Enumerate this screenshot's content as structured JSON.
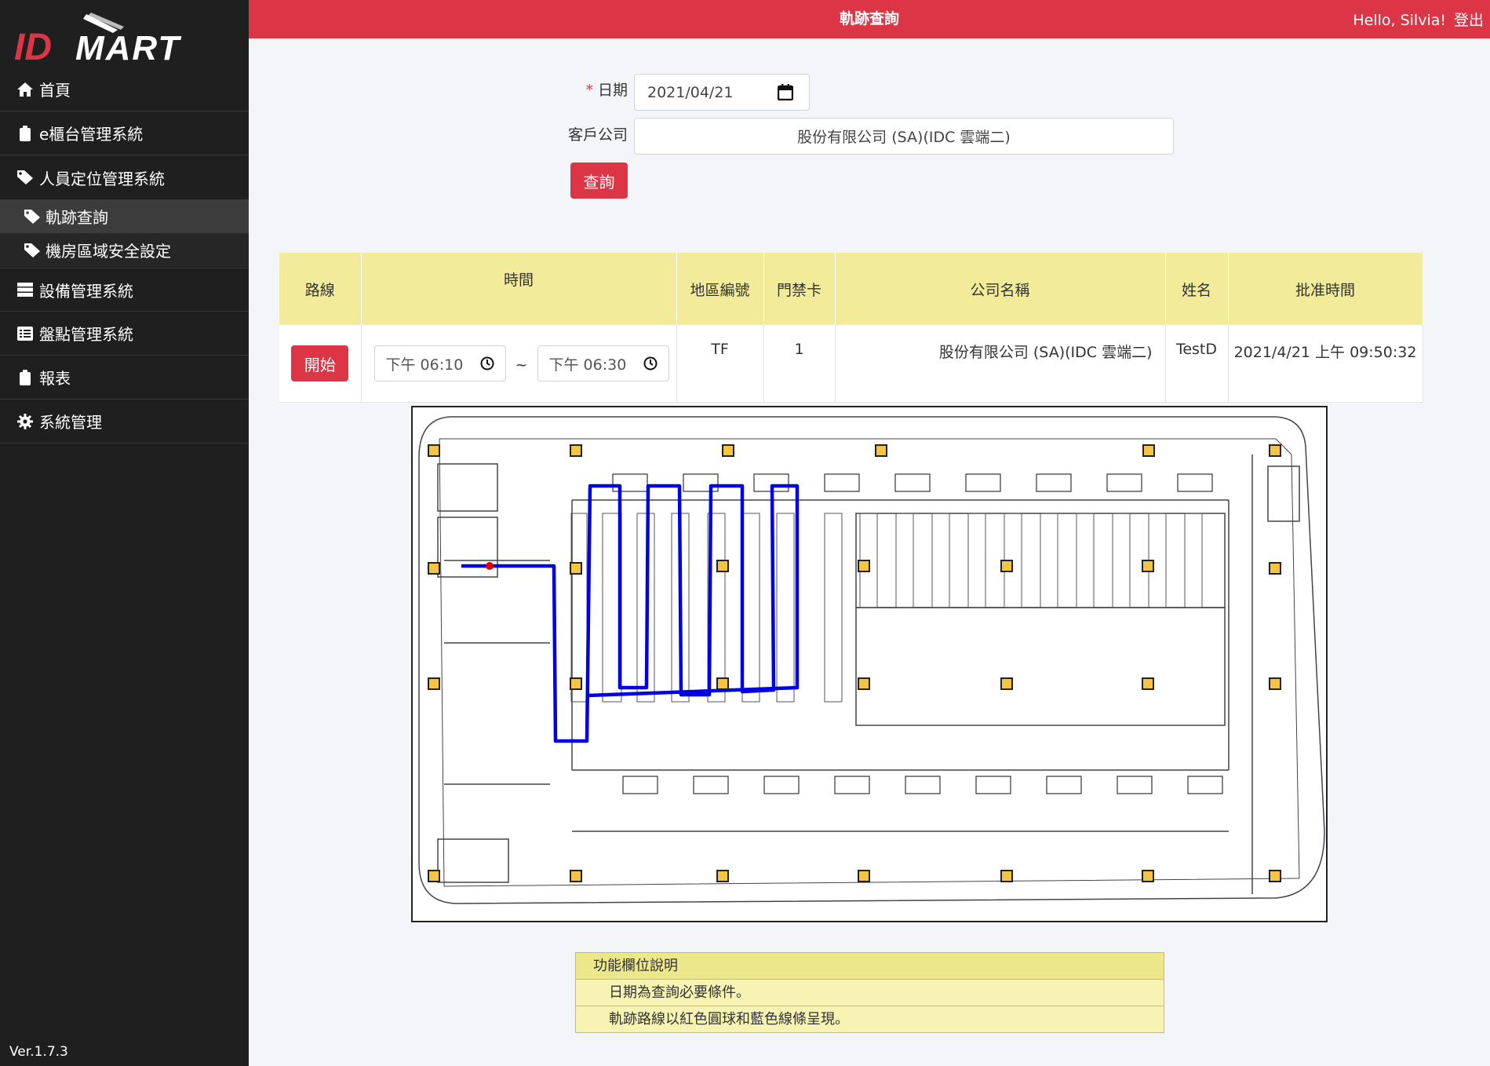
{
  "app": {
    "brand": "IDMART",
    "version": "Ver.1.7.3"
  },
  "header": {
    "title": "軌跡查詢",
    "greeting": "Hello, Silvia!",
    "logout": "登出"
  },
  "sidebar": {
    "items": [
      {
        "label": "首頁",
        "icon": "home-icon"
      },
      {
        "label": "e櫃台管理系統",
        "icon": "clipboard-icon"
      },
      {
        "label": "人員定位管理系統",
        "icon": "tag-icon"
      },
      {
        "label": "設備管理系統",
        "icon": "server-icon"
      },
      {
        "label": "盤點管理系統",
        "icon": "list-icon"
      },
      {
        "label": "報表",
        "icon": "clipboard-icon"
      },
      {
        "label": "系統管理",
        "icon": "gear-icon"
      }
    ],
    "subitems": [
      {
        "label": "軌跡查詢",
        "icon": "tag-icon",
        "active": true
      },
      {
        "label": "機房區域安全設定",
        "icon": "tag-icon",
        "active": false
      }
    ]
  },
  "form": {
    "date_label": "日期",
    "required_mark": "*",
    "date_value": "2021/04/21",
    "company_label": "客戶公司",
    "company_value": "股份有限公司 (SA)(IDC 雲端二)",
    "search_button": "查詢"
  },
  "table": {
    "headers": [
      "路線",
      "時間",
      "地區編號",
      "門禁卡",
      "公司名稱",
      "姓名",
      "批准時間"
    ],
    "rows": [
      {
        "route_button": "開始",
        "time_start": "下午 06:10",
        "time_sep": "~",
        "time_end": "下午 06:30",
        "area_code": "TF",
        "access_card": "1",
        "company": "股份有限公司 (SA)(IDC 雲端二)",
        "name": "TestD",
        "approved_time": "2021/4/21 上午 09:50:32"
      }
    ]
  },
  "legend": {
    "title": "功能欄位說明",
    "rows": [
      "日期為查詢必要條件。",
      "軌跡路線以紅色圓球和藍色線條呈現。"
    ]
  },
  "colors": {
    "accent": "#dc3545",
    "sidebar": "#1f1f1f",
    "table_header": "#f2ec9a",
    "track_line": "#0000e6",
    "track_point": "#e60000"
  }
}
